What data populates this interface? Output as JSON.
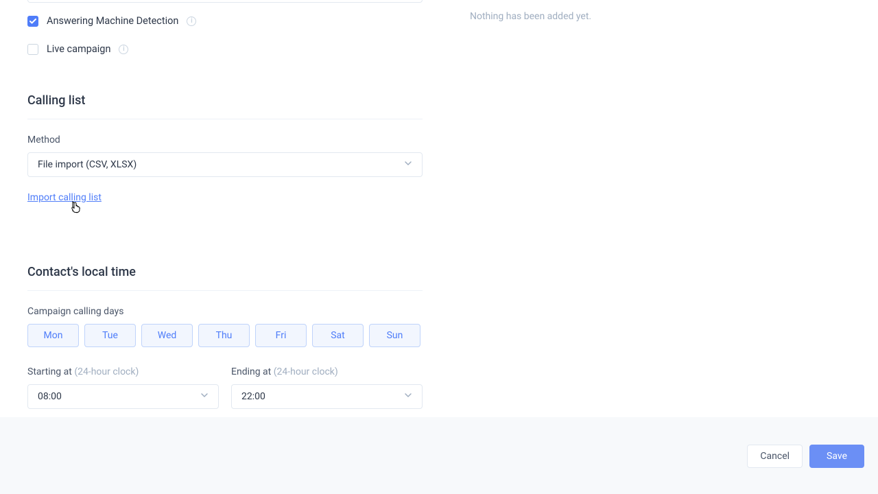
{
  "right": {
    "empty_text": "Nothing has been added yet."
  },
  "checkboxes": {
    "amd": {
      "label": "Answering Machine Detection",
      "checked": true
    },
    "live": {
      "label": "Live campaign",
      "checked": false
    }
  },
  "calling_list": {
    "title": "Calling list",
    "method_label": "Method",
    "method_value": "File import (CSV, XLSX)",
    "import_link": "Import calling list"
  },
  "local_time": {
    "title": "Contact's local time",
    "days_label": "Campaign calling days",
    "days": [
      "Mon",
      "Tue",
      "Wed",
      "Thu",
      "Fri",
      "Sat",
      "Sun"
    ],
    "start_label": "Starting at ",
    "start_hint": "(24-hour clock)",
    "start_value": "08:00",
    "end_label": "Ending at ",
    "end_hint": "(24-hour clock)",
    "end_value": "22:00"
  },
  "footer": {
    "cancel": "Cancel",
    "save": "Save"
  }
}
